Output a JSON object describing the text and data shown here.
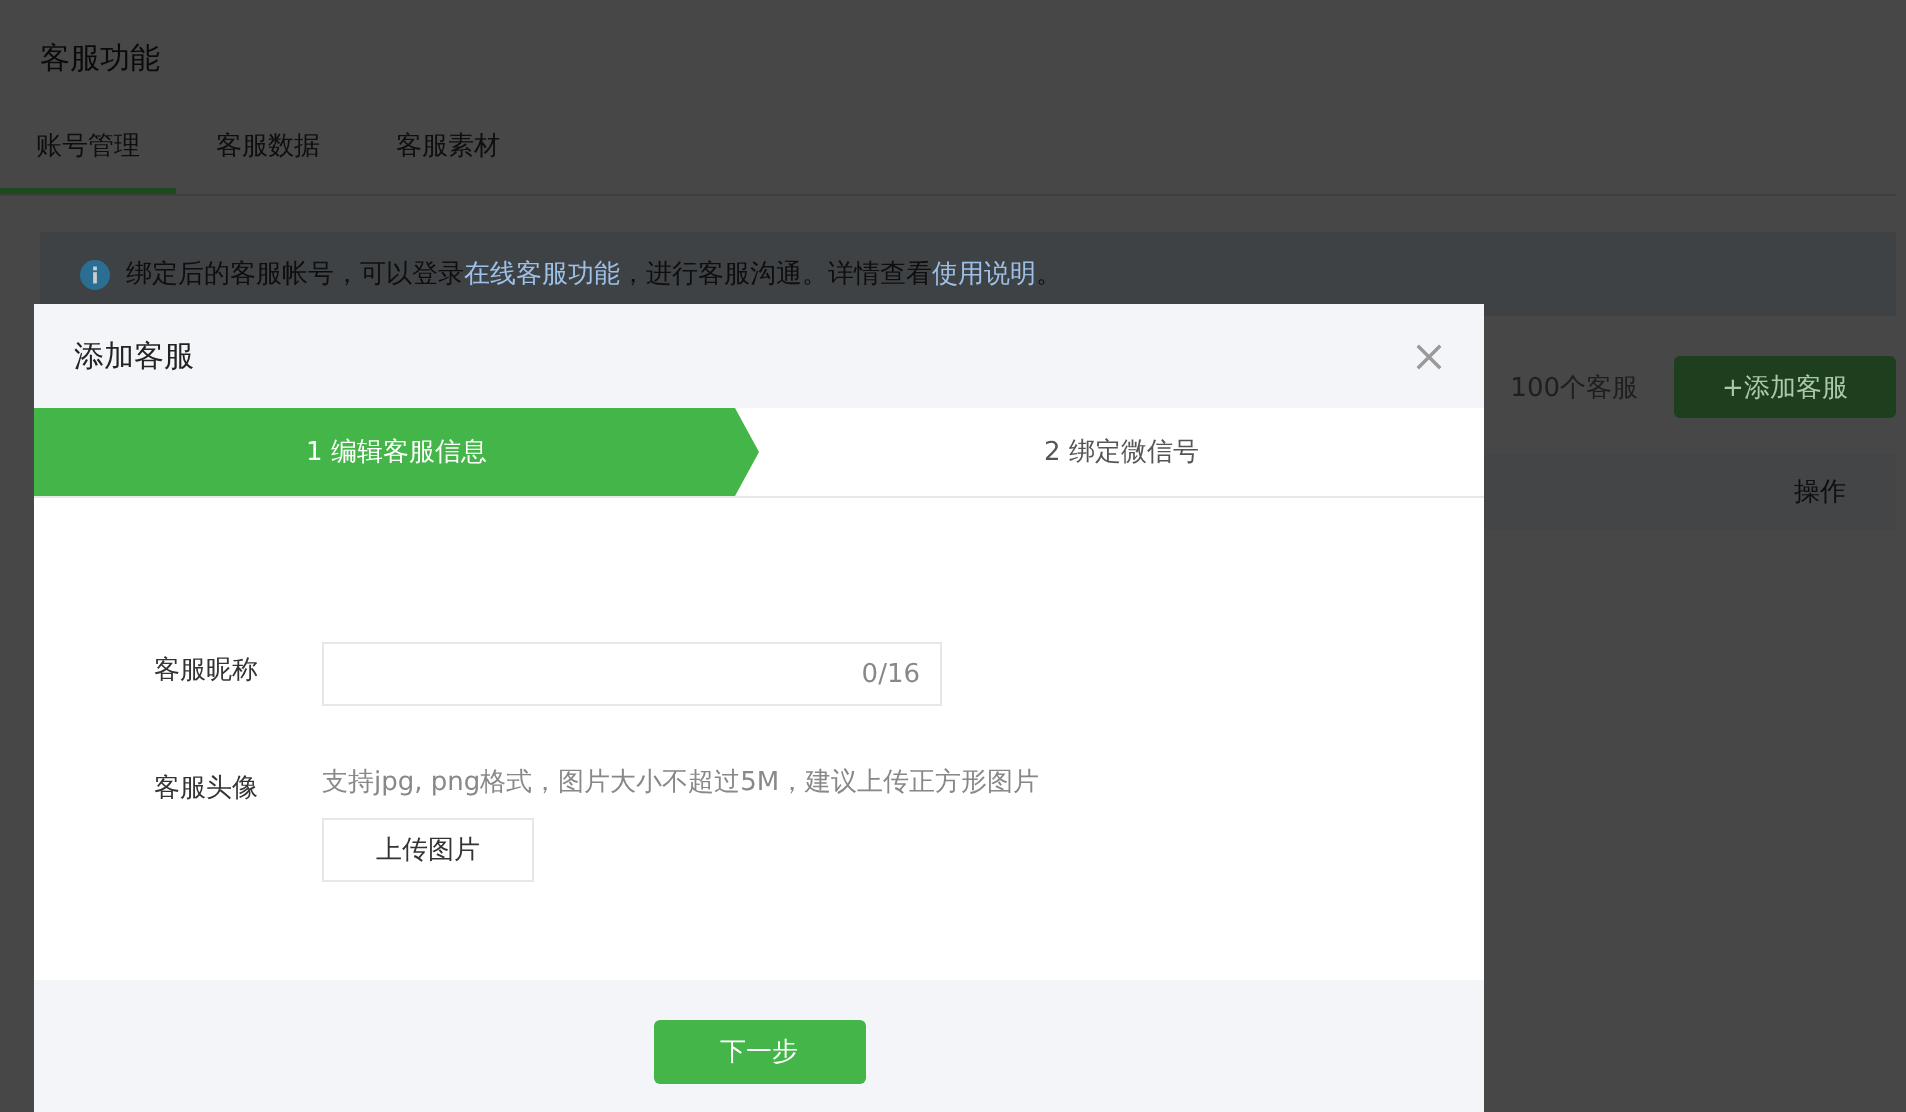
{
  "page": {
    "title": "客服功能",
    "tabs": [
      {
        "label": "账号管理",
        "selected": true
      },
      {
        "label": "客服数据",
        "selected": false
      },
      {
        "label": "客服素材",
        "selected": false
      }
    ],
    "notice": {
      "parts": [
        {
          "kind": "text",
          "text": "绑定后的客服帐号，可以登录"
        },
        {
          "kind": "link",
          "text": "在线客服功能"
        },
        {
          "kind": "text",
          "text": "，进行客服沟通。详情查看"
        },
        {
          "kind": "link",
          "text": "使用说明"
        },
        {
          "kind": "text",
          "text": "。"
        }
      ]
    },
    "limit_text": "100个客服",
    "add_button": "+添加客服",
    "table": {
      "columns": [
        "操作"
      ]
    }
  },
  "dialog": {
    "title": "添加客服",
    "steps": [
      {
        "label": "1 编辑客服信息",
        "selected": true
      },
      {
        "label": "2 绑定微信号",
        "selected": false
      }
    ],
    "fields": [
      {
        "kind": "input",
        "label": "客服昵称",
        "counter": "0/16"
      },
      {
        "kind": "upload",
        "label": "客服头像",
        "hint": "支持jpg, png格式，图片大小不超过5M，建议上传正方形图片",
        "button": "上传图片"
      }
    ],
    "next_button": "下一步"
  }
}
